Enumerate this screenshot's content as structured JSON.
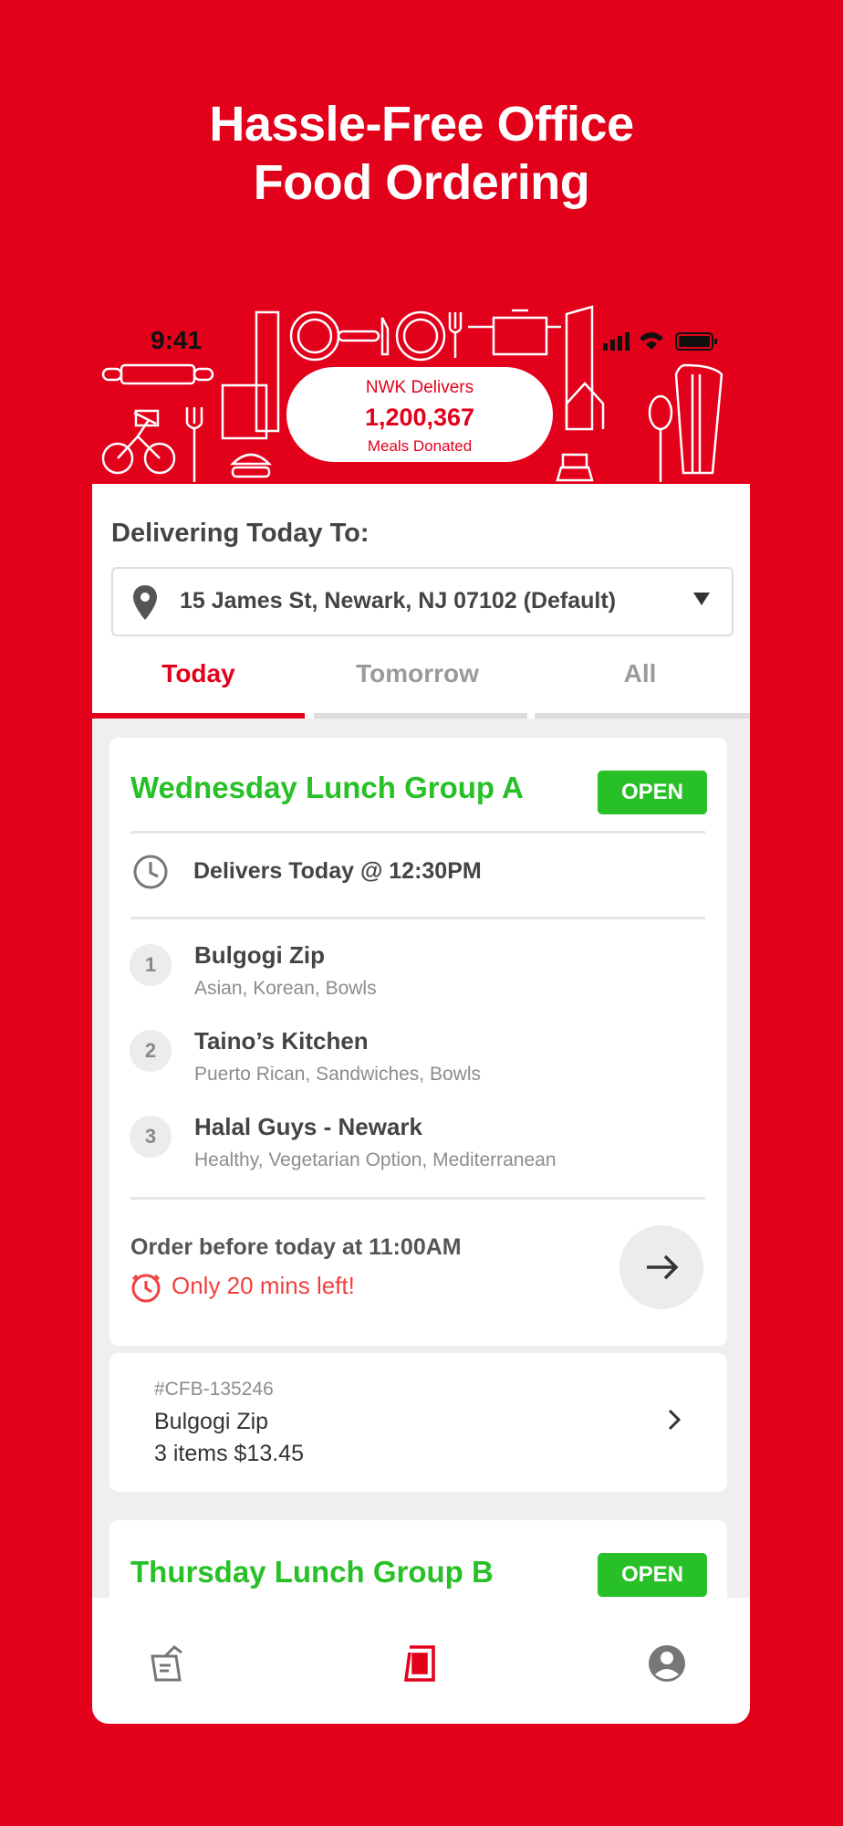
{
  "promo": {
    "headline_line1": "Hassle-Free Office",
    "headline_line2": "Food Ordering"
  },
  "status_bar": {
    "time": "9:41"
  },
  "donation": {
    "label": "NWK Delivers",
    "count": "1,200,367",
    "sublabel": "Meals Donated"
  },
  "delivery": {
    "label": "Delivering Today To:",
    "address": "15 James St, Newark, NJ 07102 (Default)"
  },
  "tabs": [
    {
      "label": "Today",
      "active": true
    },
    {
      "label": "Tomorrow",
      "active": false
    },
    {
      "label": "All",
      "active": false
    }
  ],
  "group_a": {
    "title": "Wednesday Lunch Group A",
    "status": "OPEN",
    "delivers": "Delivers Today @ 12:30PM",
    "restaurants": [
      {
        "num": "1",
        "name": "Bulgogi Zip",
        "tags": "Asian, Korean, Bowls"
      },
      {
        "num": "2",
        "name": "Taino’s Kitchen",
        "tags": "Puerto Rican, Sandwiches, Bowls"
      },
      {
        "num": "3",
        "name": "Halal Guys - Newark",
        "tags": "Healthy, Vegetarian Option, Mediterranean"
      }
    ],
    "order_before": "Order before today at 11:00AM",
    "time_left": "Only 20 mins left!"
  },
  "order": {
    "id": "#CFB-135246",
    "restaurant": "Bulgogi Zip",
    "summary": "3 items $13.45"
  },
  "group_b": {
    "title": "Thursday Lunch Group B",
    "status": "OPEN"
  },
  "colors": {
    "brand_red": "#e2001a",
    "open_green": "#27c027",
    "warning_red": "#f04040"
  },
  "nav": {
    "items": [
      {
        "icon": "orders-history-icon"
      },
      {
        "icon": "menu-board-icon",
        "active": true
      },
      {
        "icon": "account-icon"
      }
    ]
  }
}
